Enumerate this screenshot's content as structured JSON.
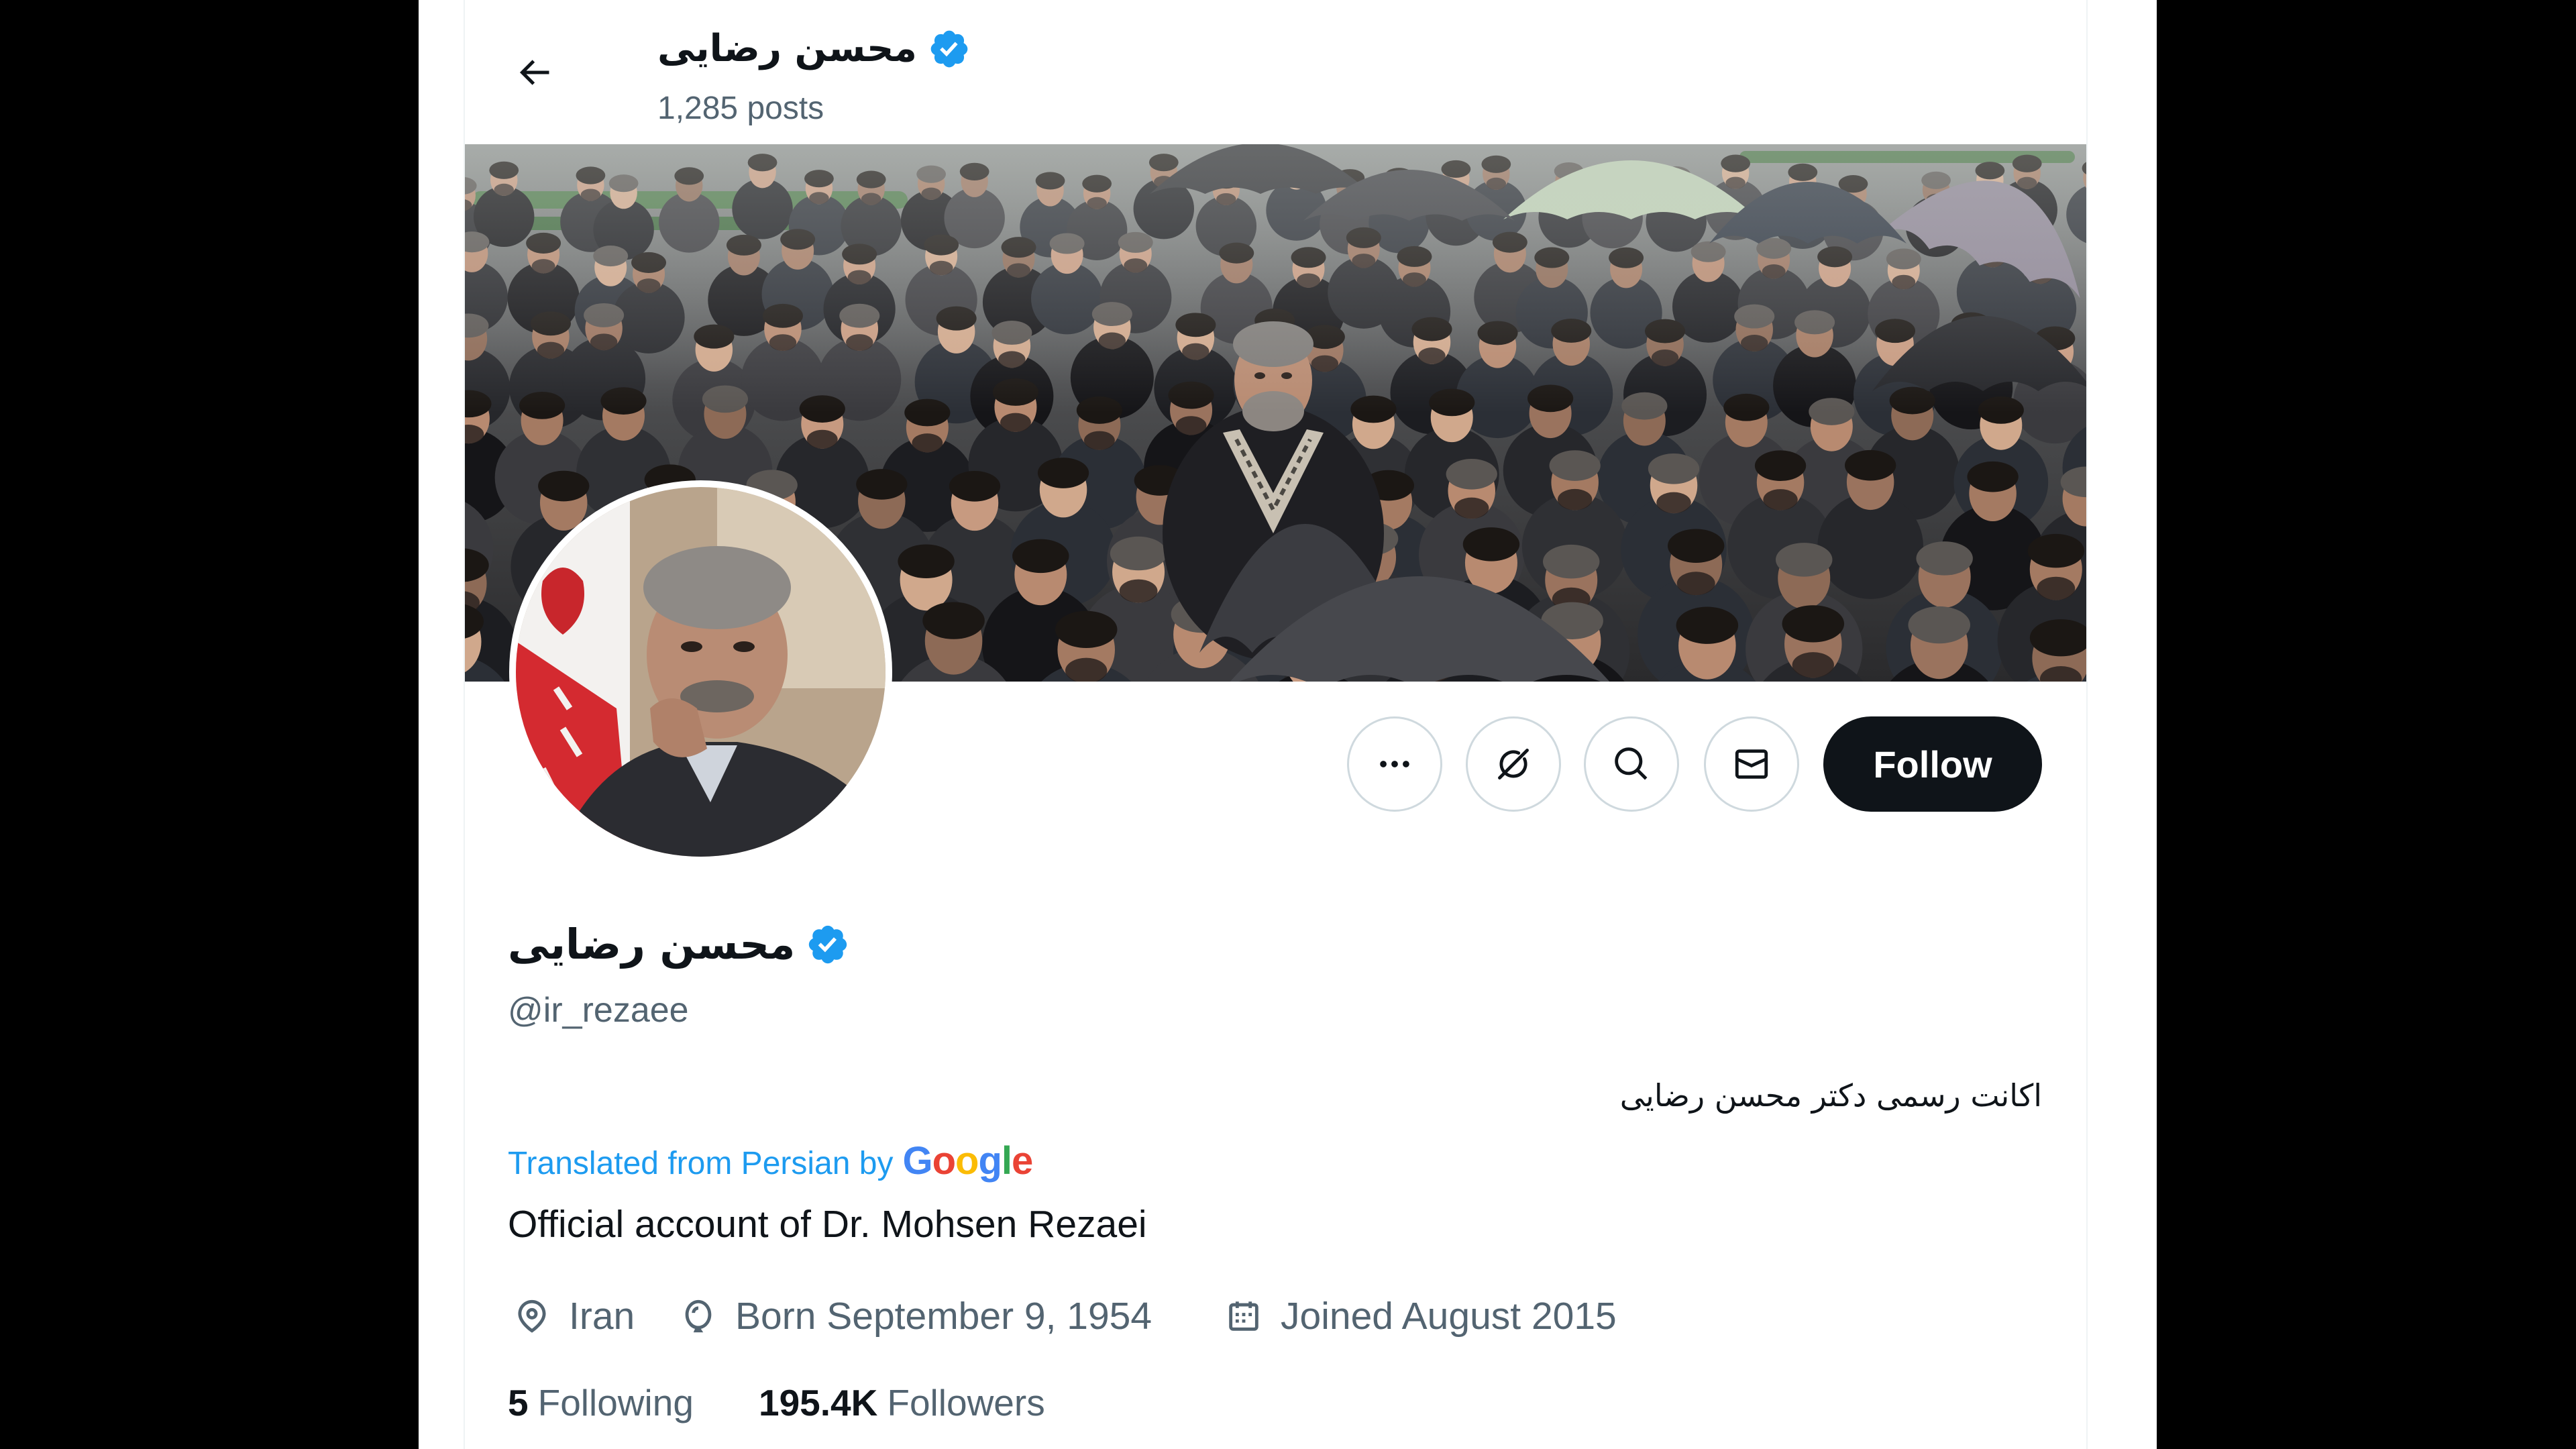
{
  "header": {
    "title": "محسن رضایی",
    "posts": "1,285 posts"
  },
  "actions": {
    "follow_label": "Follow"
  },
  "profile": {
    "name": "محسن رضایی",
    "handle": "@ir_rezaee",
    "bio_original": "اکانت رسمی دکتر محسن رضایی",
    "translation_prefix": "Translated from Persian by",
    "translation_provider": "Google",
    "bio_translated": "Official account of Dr. Mohsen Rezaei",
    "location": "Iran",
    "birthday": "Born September 9, 1954",
    "joined": "Joined August 2015",
    "following_count": "5",
    "following_label": "Following",
    "followers_count": "195.4K",
    "followers_label": "Followers"
  },
  "icons": {
    "back": "back-arrow-icon",
    "verified": "verified-badge-icon",
    "more": "more-icon",
    "grok": "grok-icon",
    "search": "search-icon",
    "message": "mail-icon",
    "location": "location-icon",
    "birthday": "balloon-icon",
    "joined": "calendar-icon"
  },
  "colors": {
    "accent": "#1d9bf0",
    "text": "#0f1419",
    "muted": "#536471",
    "follow_button": "#0f1419",
    "google_logo": [
      "#4285F4",
      "#EA4335",
      "#FBBC05",
      "#4285F4",
      "#34A853",
      "#EA4335"
    ]
  }
}
